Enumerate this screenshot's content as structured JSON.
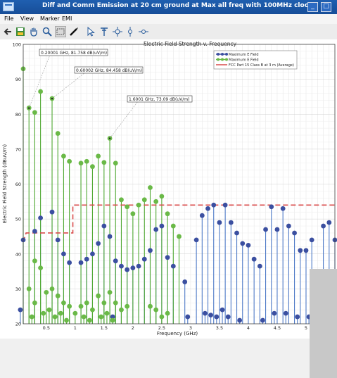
{
  "window": {
    "title": "Diff and Comm Emission at 20 cm ground at Max all freq with 100MHz clock"
  },
  "menu": {
    "items": [
      "File",
      "View",
      "Marker",
      "EMI"
    ]
  },
  "toolbar": {
    "icons": [
      "back-arrow-icon",
      "save-icon",
      "pan-hand-icon",
      "zoom-icon",
      "select-box-icon",
      "pen-icon",
      "cursor-icon",
      "marker-flag-icon",
      "crosshair-icon",
      "vertical-marker-icon",
      "horizontal-marker-icon"
    ]
  },
  "chart_data": {
    "type": "scatter",
    "title": "Electric Field Strength v. Frequency",
    "xlabel": "Frequency (GHz)",
    "ylabel": "Electric Field Strength (dBuV/m)",
    "xlim": [
      0.1,
      5.5
    ],
    "ylim": [
      20,
      100
    ],
    "xticks": [
      "0.5",
      "1",
      "1.5",
      "2",
      "2.5",
      "3",
      "3.5",
      "4",
      "4.5",
      "5"
    ],
    "yticks": [
      "20",
      "30",
      "40",
      "50",
      "60",
      "70",
      "80",
      "90",
      "100"
    ],
    "grid": true,
    "legend": {
      "placement": "top-right",
      "entries": [
        "Maximum E Field",
        "Maximum E Field",
        "FCC Part 15 Class B at 3 m (Average)"
      ]
    },
    "series": [
      {
        "name": "Maximum E Field",
        "color": "#3b4fa0",
        "stem_color": "#4e7ac7",
        "points": [
          [
            0.1,
            44
          ],
          [
            0.3,
            46.5
          ],
          [
            0.4,
            50.3
          ],
          [
            0.6,
            52
          ],
          [
            0.7,
            44
          ],
          [
            0.8,
            40
          ],
          [
            0.9,
            37.5
          ],
          [
            1.1,
            37.5
          ],
          [
            1.2,
            38.5
          ],
          [
            1.3,
            40
          ],
          [
            1.4,
            43
          ],
          [
            1.5,
            48
          ],
          [
            1.6,
            45
          ],
          [
            1.7,
            38
          ],
          [
            1.8,
            36.5
          ],
          [
            1.9,
            35.5
          ],
          [
            2.0,
            36
          ],
          [
            2.1,
            36.5
          ],
          [
            2.2,
            38.5
          ],
          [
            2.3,
            41
          ],
          [
            2.4,
            47
          ],
          [
            2.5,
            48
          ],
          [
            2.6,
            39
          ],
          [
            2.7,
            36.5
          ],
          [
            2.9,
            32
          ],
          [
            3.1,
            44
          ],
          [
            3.2,
            51
          ],
          [
            3.25,
            23
          ],
          [
            3.3,
            53
          ],
          [
            3.4,
            54
          ],
          [
            3.5,
            49
          ],
          [
            3.6,
            54
          ],
          [
            3.7,
            49
          ],
          [
            3.8,
            46
          ],
          [
            3.9,
            43
          ],
          [
            4.0,
            42.5
          ],
          [
            4.1,
            38.5
          ],
          [
            4.2,
            36.5
          ],
          [
            4.3,
            47
          ],
          [
            4.4,
            53.5
          ],
          [
            4.5,
            47
          ],
          [
            4.6,
            53
          ],
          [
            4.7,
            48
          ],
          [
            4.8,
            46
          ],
          [
            4.9,
            41
          ],
          [
            5.0,
            41
          ],
          [
            5.1,
            44
          ],
          [
            5.3,
            48
          ],
          [
            5.4,
            49
          ],
          [
            5.5,
            44
          ],
          [
            0.05,
            24
          ],
          [
            1.65,
            22
          ],
          [
            2.95,
            22
          ],
          [
            3.35,
            22.5
          ],
          [
            3.45,
            22
          ],
          [
            3.55,
            24
          ],
          [
            3.65,
            22
          ],
          [
            3.85,
            21
          ],
          [
            4.25,
            21
          ],
          [
            4.45,
            23
          ],
          [
            4.65,
            23
          ],
          [
            4.85,
            22
          ],
          [
            5.05,
            22
          ],
          [
            5.15,
            21
          ]
        ]
      },
      {
        "name": "Maximum E Field",
        "color": "#6ab947",
        "stem_color": "#4fa832",
        "points": [
          [
            0.1,
            93
          ],
          [
            0.2,
            81.8
          ],
          [
            0.3,
            80.5
          ],
          [
            0.4,
            86.5
          ],
          [
            0.6,
            84.5
          ],
          [
            0.7,
            74.5
          ],
          [
            0.8,
            68
          ],
          [
            0.9,
            66.5
          ],
          [
            1.1,
            66
          ],
          [
            1.2,
            66.5
          ],
          [
            1.3,
            65
          ],
          [
            1.4,
            68
          ],
          [
            1.5,
            66.2
          ],
          [
            1.6,
            73.1
          ],
          [
            1.7,
            66
          ],
          [
            1.8,
            55.5
          ],
          [
            1.9,
            53.5
          ],
          [
            2.0,
            51.5
          ],
          [
            2.1,
            54
          ],
          [
            2.2,
            55.5
          ],
          [
            2.3,
            59
          ],
          [
            2.4,
            55
          ],
          [
            2.5,
            56.5
          ],
          [
            2.6,
            51.5
          ],
          [
            2.7,
            48
          ],
          [
            2.8,
            45
          ],
          [
            0.2,
            30
          ],
          [
            0.3,
            26
          ],
          [
            0.4,
            36
          ],
          [
            0.5,
            29
          ],
          [
            0.6,
            30
          ],
          [
            0.7,
            28
          ],
          [
            0.8,
            26
          ],
          [
            0.9,
            25
          ],
          [
            1.0,
            23
          ],
          [
            1.1,
            25
          ],
          [
            1.2,
            26
          ],
          [
            1.3,
            24
          ],
          [
            1.4,
            28
          ],
          [
            1.5,
            26
          ],
          [
            1.6,
            29
          ],
          [
            1.7,
            26
          ],
          [
            1.8,
            24
          ],
          [
            1.9,
            25
          ],
          [
            0.25,
            22
          ],
          [
            0.45,
            23
          ],
          [
            0.55,
            24
          ],
          [
            0.65,
            22
          ],
          [
            0.75,
            23
          ],
          [
            0.85,
            21
          ],
          [
            1.15,
            22
          ],
          [
            1.25,
            21
          ],
          [
            1.45,
            22
          ],
          [
            1.55,
            23
          ],
          [
            1.65,
            21
          ],
          [
            2.3,
            25
          ],
          [
            2.4,
            24
          ],
          [
            2.5,
            22
          ],
          [
            2.6,
            23
          ],
          [
            0.3,
            38
          ]
        ]
      }
    ],
    "limit_line": {
      "name": "FCC Part 15 Class B at 3 m (Average)",
      "color": "#d94b4b",
      "points": [
        [
          0.1,
          43.5
        ],
        [
          0.15,
          46
        ],
        [
          0.96,
          46
        ],
        [
          0.96,
          54
        ],
        [
          5.5,
          54
        ]
      ]
    },
    "annotations": [
      "0.20001 GHz, 81.758 dB(uV/m)",
      "0.60002 GHz, 84.458 dB(uV/m)",
      "1.6001 GHz, 73.09 dB(uV/m)"
    ]
  }
}
